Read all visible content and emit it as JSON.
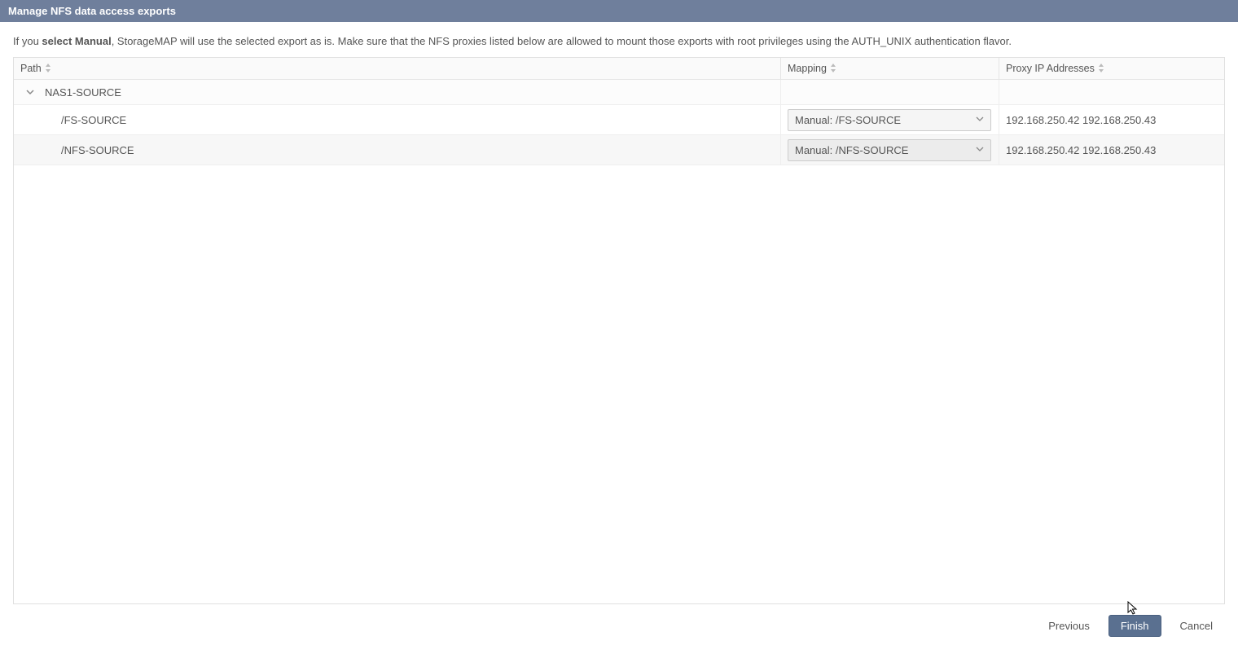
{
  "header": {
    "title": "Manage NFS data access exports"
  },
  "info": {
    "prefix": "If you ",
    "bold": "select Manual",
    "suffix": ", StorageMAP will use the selected export as is. Make sure that the NFS proxies listed below are allowed to mount those exports with root privileges using the AUTH_UNIX authentication flavor."
  },
  "columns": {
    "path": "Path",
    "mapping": "Mapping",
    "proxy": "Proxy IP Addresses"
  },
  "tree": {
    "parent": "NAS1-SOURCE",
    "rows": [
      {
        "path": "/FS-SOURCE",
        "mapping": "Manual: /FS-SOURCE",
        "proxy": "192.168.250.42 192.168.250.43"
      },
      {
        "path": "/NFS-SOURCE",
        "mapping": "Manual: /NFS-SOURCE",
        "proxy": "192.168.250.42 192.168.250.43"
      }
    ]
  },
  "footer": {
    "previous": "Previous",
    "finish": "Finish",
    "cancel": "Cancel"
  }
}
